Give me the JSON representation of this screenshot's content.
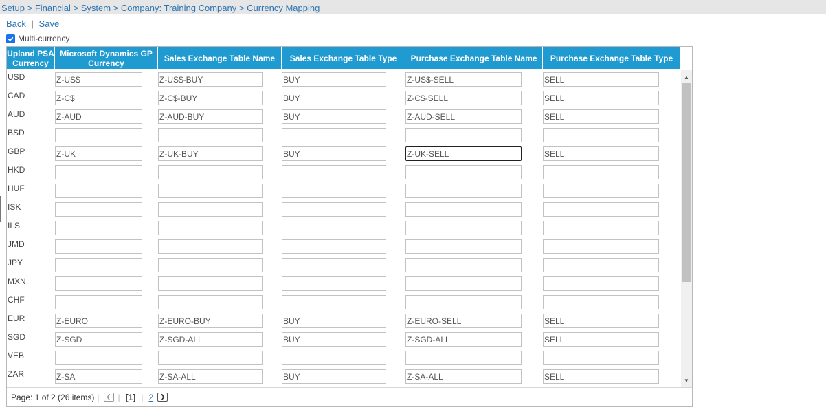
{
  "breadcrumb": {
    "setup": "Setup",
    "financial": "Financial",
    "system": "System",
    "company": "Company: Training Company",
    "current": "Currency Mapping",
    "separator": ">"
  },
  "actions": {
    "back": "Back",
    "divider": "|",
    "save": "Save"
  },
  "multi_currency": {
    "label": "Multi-currency",
    "checked": true
  },
  "columns": {
    "psa": "Upland PSA Currency",
    "gp": "Microsoft Dynamics GP Currency",
    "sales_name": "Sales Exchange Table Name",
    "sales_type": "Sales Exchange Table Type",
    "purchase_name": "Purchase Exchange Table Name",
    "purchase_type": "Purchase Exchange Table Type"
  },
  "rows": [
    {
      "code": "USD",
      "gp": "Z-US$",
      "sales_name": "Z-US$-BUY",
      "sales_type": "BUY",
      "purchase_name": "Z-US$-SELL",
      "purchase_type": "SELL"
    },
    {
      "code": "CAD",
      "gp": "Z-C$",
      "sales_name": "Z-C$-BUY",
      "sales_type": "BUY",
      "purchase_name": "Z-C$-SELL",
      "purchase_type": "SELL"
    },
    {
      "code": "AUD",
      "gp": "Z-AUD",
      "sales_name": "Z-AUD-BUY",
      "sales_type": "BUY",
      "purchase_name": "Z-AUD-SELL",
      "purchase_type": "SELL"
    },
    {
      "code": "BSD",
      "gp": "",
      "sales_name": "",
      "sales_type": "",
      "purchase_name": "",
      "purchase_type": ""
    },
    {
      "code": "GBP",
      "gp": "Z-UK",
      "sales_name": "Z-UK-BUY",
      "sales_type": "BUY",
      "purchase_name": "Z-UK-SELL",
      "purchase_type": "SELL"
    },
    {
      "code": "HKD",
      "gp": "",
      "sales_name": "",
      "sales_type": "",
      "purchase_name": "",
      "purchase_type": ""
    },
    {
      "code": "HUF",
      "gp": "",
      "sales_name": "",
      "sales_type": "",
      "purchase_name": "",
      "purchase_type": ""
    },
    {
      "code": "ISK",
      "gp": "",
      "sales_name": "",
      "sales_type": "",
      "purchase_name": "",
      "purchase_type": ""
    },
    {
      "code": "ILS",
      "gp": "",
      "sales_name": "",
      "sales_type": "",
      "purchase_name": "",
      "purchase_type": ""
    },
    {
      "code": "JMD",
      "gp": "",
      "sales_name": "",
      "sales_type": "",
      "purchase_name": "",
      "purchase_type": ""
    },
    {
      "code": "JPY",
      "gp": "",
      "sales_name": "",
      "sales_type": "",
      "purchase_name": "",
      "purchase_type": ""
    },
    {
      "code": "MXN",
      "gp": "",
      "sales_name": "",
      "sales_type": "",
      "purchase_name": "",
      "purchase_type": ""
    },
    {
      "code": "CHF",
      "gp": "",
      "sales_name": "",
      "sales_type": "",
      "purchase_name": "",
      "purchase_type": ""
    },
    {
      "code": "EUR",
      "gp": "Z-EURO",
      "sales_name": "Z-EURO-BUY",
      "sales_type": "BUY",
      "purchase_name": "Z-EURO-SELL",
      "purchase_type": "SELL"
    },
    {
      "code": "SGD",
      "gp": "Z-SGD",
      "sales_name": "Z-SGD-ALL",
      "sales_type": "BUY",
      "purchase_name": "Z-SGD-ALL",
      "purchase_type": "SELL"
    },
    {
      "code": "VEB",
      "gp": "",
      "sales_name": "",
      "sales_type": "",
      "purchase_name": "",
      "purchase_type": ""
    },
    {
      "code": "ZAR",
      "gp": "Z-SA",
      "sales_name": "Z-SA-ALL",
      "sales_type": "BUY",
      "purchase_name": "Z-SA-ALL",
      "purchase_type": "SELL"
    }
  ],
  "focused_cell": {
    "row": 4,
    "field": "purchase_name"
  },
  "pager": {
    "summary": "Page: 1 of 2 (26 items)",
    "current": "[1]",
    "next_page": "2",
    "prev_icon": "chevron-left-icon",
    "next_icon": "chevron-right-icon"
  },
  "colors": {
    "header_bg": "#1f9bd1",
    "link": "#2e74b5",
    "checkbox": "#1a73e8"
  }
}
